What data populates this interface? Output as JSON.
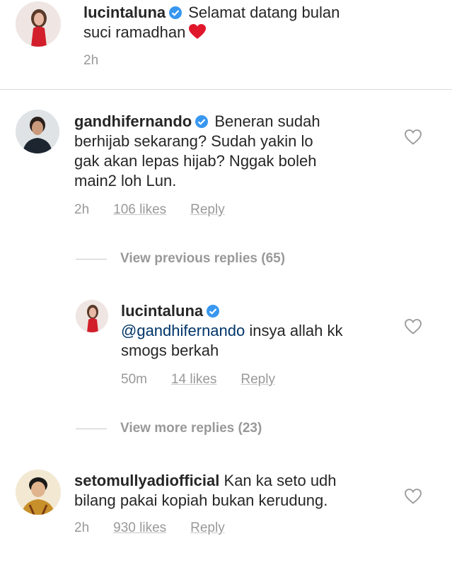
{
  "caption": {
    "username": "lucintaluna",
    "text": "Selamat datang bulan",
    "text2": "suci ramadhan",
    "time": "2h"
  },
  "comments": [
    {
      "username": "gandhifernando",
      "line1": "Beneran sudah",
      "line2": "berhijab sekarang? Sudah yakin lo",
      "line3": "gak akan lepas hijab? Nggak boleh",
      "line4": "main2 loh Lun.",
      "time": "2h",
      "likes": "106 likes",
      "reply": "Reply"
    },
    {
      "username": "lucintaluna",
      "mention": "@gandhifernando",
      "line1": "insya allah kk",
      "line2": "smogs berkah",
      "time": "50m",
      "likes": "14 likes",
      "reply": "Reply"
    },
    {
      "username": "setomullyadiofficial",
      "line1": "Kan ka seto udh",
      "line2": "bilang pakai kopiah bukan kerudung.",
      "time": "2h",
      "likes": "930 likes",
      "reply": "Reply"
    }
  ],
  "view_previous": "View previous replies (65)",
  "view_more": "View more replies (23)",
  "colors": {
    "verified": "#3897f0",
    "meta": "#999999",
    "mention": "#003569"
  },
  "icons": [
    "verified-badge-icon",
    "heart-outline-icon",
    "red-heart-emoji"
  ]
}
